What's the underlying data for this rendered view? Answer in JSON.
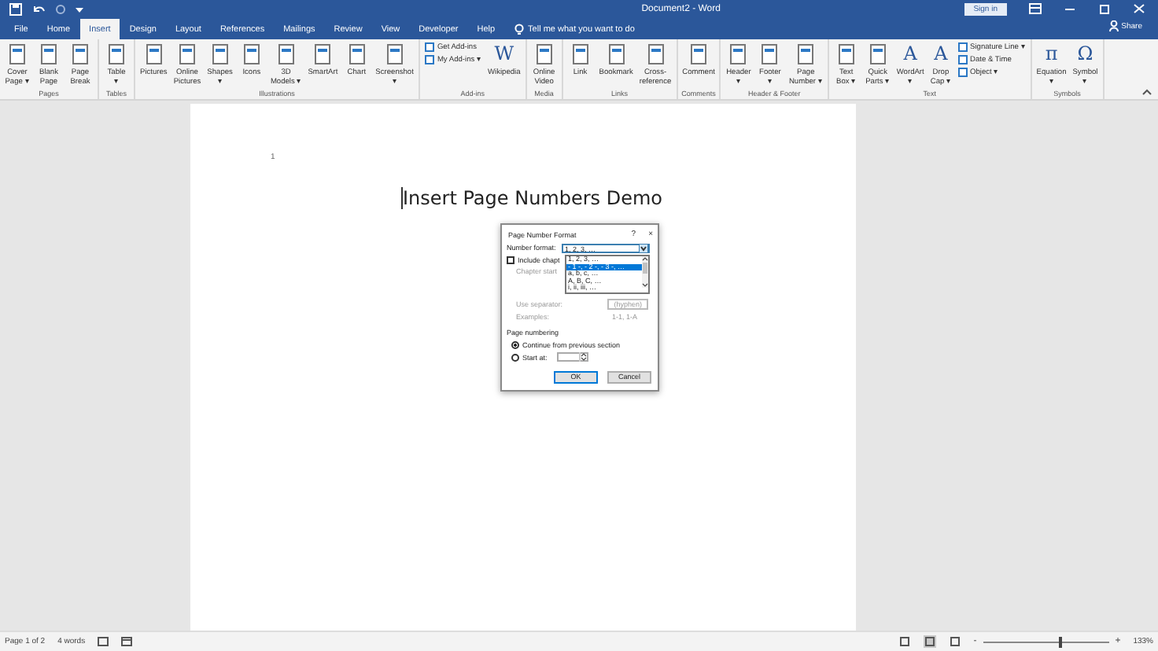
{
  "title_bar": {
    "title": "Document2 - Word",
    "sign_in": "Sign in"
  },
  "tabs": [
    {
      "label": "File",
      "selected": false
    },
    {
      "label": "Home",
      "selected": false
    },
    {
      "label": "Insert",
      "selected": true
    },
    {
      "label": "Design",
      "selected": false
    },
    {
      "label": "Layout",
      "selected": false
    },
    {
      "label": "References",
      "selected": false
    },
    {
      "label": "Mailings",
      "selected": false
    },
    {
      "label": "Review",
      "selected": false
    },
    {
      "label": "View",
      "selected": false
    },
    {
      "label": "Developer",
      "selected": false
    },
    {
      "label": "Help",
      "selected": false
    }
  ],
  "tell_me": "Tell me what you want to do",
  "share": "Share",
  "ribbon": [
    {
      "name": "Pages",
      "items": [
        {
          "kind": "large",
          "label": "Cover\nPage ▾"
        },
        {
          "kind": "large",
          "label": "Blank\nPage"
        },
        {
          "kind": "large",
          "label": "Page\nBreak"
        }
      ]
    },
    {
      "name": "Tables",
      "items": [
        {
          "kind": "large",
          "label": "Table\n▾"
        }
      ]
    },
    {
      "name": "Illustrations",
      "items": [
        {
          "kind": "large",
          "label": "Pictures"
        },
        {
          "kind": "large",
          "label": "Online\nPictures"
        },
        {
          "kind": "large",
          "label": "Shapes\n▾"
        },
        {
          "kind": "large",
          "label": "Icons"
        },
        {
          "kind": "large",
          "label": "3D\nModels ▾"
        },
        {
          "kind": "large",
          "label": "SmartArt"
        },
        {
          "kind": "large",
          "label": "Chart"
        },
        {
          "kind": "large",
          "label": "Screenshot\n▾"
        }
      ]
    },
    {
      "name": "Add-ins",
      "items": [
        {
          "kind": "stack",
          "items": [
            "Get Add-ins",
            "My Add-ins  ▾"
          ]
        },
        {
          "kind": "large",
          "label": "Wikipedia",
          "glyph": "W"
        }
      ]
    },
    {
      "name": "Media",
      "items": [
        {
          "kind": "large",
          "label": "Online\nVideo"
        }
      ]
    },
    {
      "name": "Links",
      "items": [
        {
          "kind": "large",
          "label": "Link"
        },
        {
          "kind": "large",
          "label": "Bookmark"
        },
        {
          "kind": "large",
          "label": "Cross-\nreference"
        }
      ]
    },
    {
      "name": "Comments",
      "items": [
        {
          "kind": "large",
          "label": "Comment"
        }
      ]
    },
    {
      "name": "Header & Footer",
      "items": [
        {
          "kind": "large",
          "label": "Header\n▾"
        },
        {
          "kind": "large",
          "label": "Footer\n▾"
        },
        {
          "kind": "large",
          "label": "Page\nNumber ▾"
        }
      ]
    },
    {
      "name": "Text",
      "items": [
        {
          "kind": "large",
          "label": "Text\nBox ▾"
        },
        {
          "kind": "large",
          "label": "Quick\nParts ▾"
        },
        {
          "kind": "large",
          "label": "WordArt\n▾",
          "glyph": "A"
        },
        {
          "kind": "large",
          "label": "Drop\nCap ▾",
          "glyph": "A"
        },
        {
          "kind": "stack",
          "items": [
            "Signature Line  ▾",
            "Date & Time",
            "Object  ▾"
          ]
        }
      ]
    },
    {
      "name": "Symbols",
      "items": [
        {
          "kind": "large",
          "label": "Equation\n▾",
          "glyph": "π"
        },
        {
          "kind": "large",
          "label": "Symbol\n▾",
          "glyph": "Ω"
        }
      ]
    }
  ],
  "document": {
    "header_number": "1",
    "heading": "Insert Page Numbers Demo"
  },
  "dialog": {
    "title": "Page Number Format",
    "help": "?",
    "close": "×",
    "number_format_label": "Number format:",
    "number_format_value": "1, 2, 3, …",
    "options": [
      {
        "label": "1, 2, 3, …",
        "selected": false
      },
      {
        "label": "- 1 -, - 2 -, - 3 -, …",
        "selected": true
      },
      {
        "label": "a, b, c, …",
        "selected": false
      },
      {
        "label": "A, B, C, …",
        "selected": false
      },
      {
        "label": "i, ii, iii, …",
        "selected": false
      }
    ],
    "include_chapter": {
      "label": "Include chapt",
      "checked": false
    },
    "chapter_starts_label": "Chapter start",
    "separator_label": "Use separator:",
    "separator_value": "(hyphen)",
    "examples_label": "Examples:",
    "examples_value": "1-1, 1-A",
    "section": "Page numbering",
    "numbering": [
      {
        "label": "Continue from previous section",
        "selected": true,
        "field": false
      },
      {
        "label": "Start at:",
        "selected": false,
        "field": true
      }
    ],
    "buttons": [
      {
        "label": "OK",
        "default": true
      },
      {
        "label": "Cancel",
        "default": false
      }
    ]
  },
  "status_bar": {
    "page": "Page 1 of 2",
    "words": "4 words",
    "views": [
      {
        "selected": false
      },
      {
        "selected": true
      },
      {
        "selected": false
      }
    ],
    "zoom": {
      "minus": "-",
      "plus": "+",
      "level": 0.6,
      "reading": "133%"
    }
  }
}
